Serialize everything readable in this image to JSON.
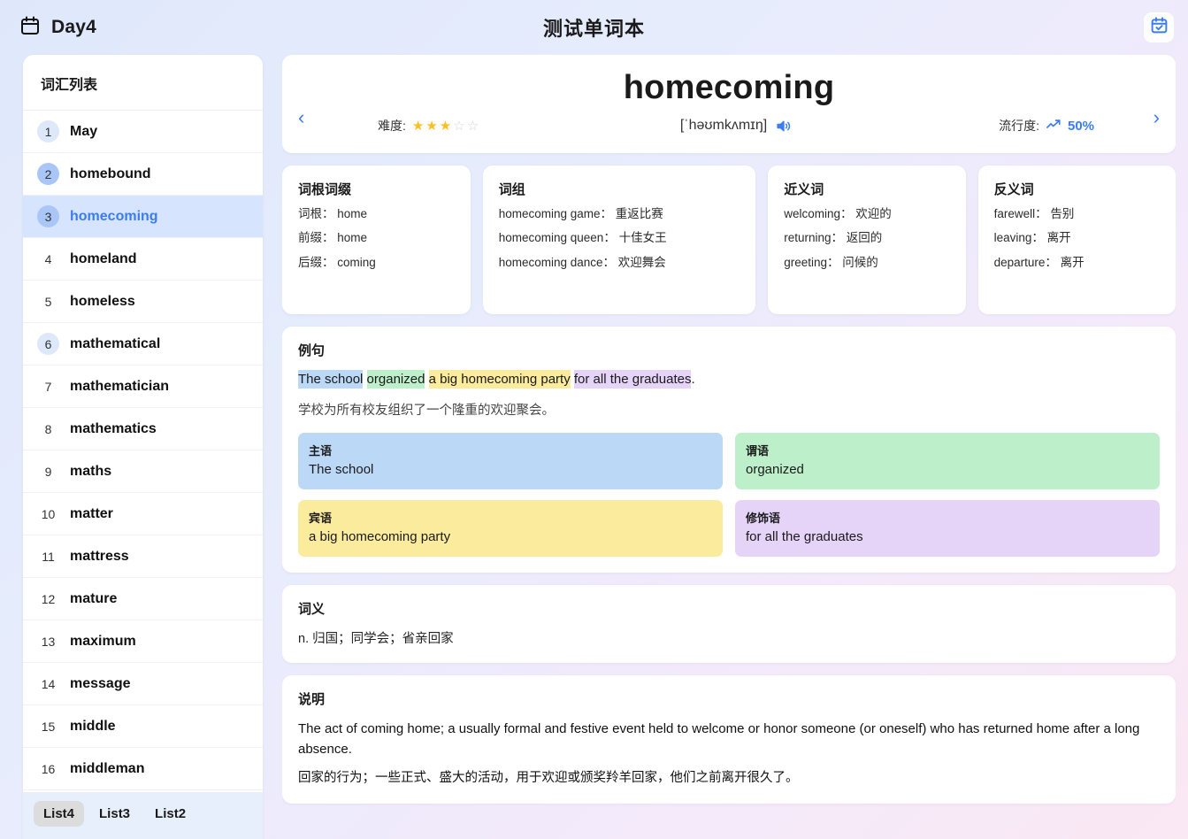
{
  "header": {
    "day_label": "Day4",
    "title": "测试单词本",
    "calendar_icon": "calendar-icon",
    "calendar_check_icon": "calendar-check-icon"
  },
  "sidebar": {
    "title": "词汇列表",
    "items": [
      {
        "num": "1",
        "word": "May",
        "badge": "light",
        "active": false
      },
      {
        "num": "2",
        "word": "homebound",
        "badge": "dark",
        "active": false
      },
      {
        "num": "3",
        "word": "homecoming",
        "badge": "dark",
        "active": true
      },
      {
        "num": "4",
        "word": "homeland",
        "badge": "none",
        "active": false
      },
      {
        "num": "5",
        "word": "homeless",
        "badge": "none",
        "active": false
      },
      {
        "num": "6",
        "word": "mathematical",
        "badge": "light",
        "active": false
      },
      {
        "num": "7",
        "word": "mathematician",
        "badge": "none",
        "active": false
      },
      {
        "num": "8",
        "word": "mathematics",
        "badge": "none",
        "active": false
      },
      {
        "num": "9",
        "word": "maths",
        "badge": "none",
        "active": false
      },
      {
        "num": "10",
        "word": "matter",
        "badge": "none",
        "active": false
      },
      {
        "num": "11",
        "word": "mattress",
        "badge": "none",
        "active": false
      },
      {
        "num": "12",
        "word": "mature",
        "badge": "none",
        "active": false
      },
      {
        "num": "13",
        "word": "maximum",
        "badge": "none",
        "active": false
      },
      {
        "num": "14",
        "word": "message",
        "badge": "none",
        "active": false
      },
      {
        "num": "15",
        "word": "middle",
        "badge": "none",
        "active": false
      },
      {
        "num": "16",
        "word": "middleman",
        "badge": "none",
        "active": false
      }
    ],
    "list_tabs": [
      {
        "label": "List4",
        "selected": true
      },
      {
        "label": "List3",
        "selected": false
      },
      {
        "label": "List2",
        "selected": false
      }
    ]
  },
  "hero": {
    "word": "homecoming",
    "phonetic": "[ˈhəʊmkʌmɪŋ]",
    "speaker_icon": "speaker-icon",
    "difficulty_label": "难度:",
    "difficulty_filled": 3,
    "difficulty_total": 5,
    "popularity_label": "流行度:",
    "popularity_value": "50%",
    "popularity_icon": "trending-up-icon",
    "prev_icon": "chevron-left-icon",
    "next_icon": "chevron-right-icon"
  },
  "info_cards": [
    {
      "title": "词根词缀",
      "lines": [
        "词根： home",
        "前缀： home",
        "后缀： coming"
      ]
    },
    {
      "title": "词组",
      "lines": [
        "homecoming game： 重返比赛",
        "homecoming queen： 十佳女王",
        "homecoming dance： 欢迎舞会"
      ]
    },
    {
      "title": "近义词",
      "lines": [
        "welcoming： 欢迎的",
        "returning： 返回的",
        "greeting： 问候的"
      ]
    },
    {
      "title": "反义词",
      "lines": [
        "farewell： 告别",
        "leaving： 离开",
        "departure： 离开"
      ]
    }
  ],
  "example": {
    "title": "例句",
    "segments": [
      {
        "text": "The school",
        "color": "#bcd8f7"
      },
      {
        "text": " ",
        "color": "transparent"
      },
      {
        "text": "organized",
        "color": "#bdf0ca"
      },
      {
        "text": " ",
        "color": "transparent"
      },
      {
        "text": "a big homecoming party",
        "color": "#fbeb9c"
      },
      {
        "text": " ",
        "color": "transparent"
      },
      {
        "text": "for all the graduates",
        "color": "#e6d4f8"
      },
      {
        "text": ".",
        "color": "transparent"
      }
    ],
    "translation": "学校为所有校友组织了一个隆重的欢迎聚会。",
    "grammar": [
      {
        "label": "主语",
        "value": "The school",
        "color": "#bcd8f7"
      },
      {
        "label": "谓语",
        "value": "organized",
        "color": "#bdf0ca"
      },
      {
        "label": "宾语",
        "value": "a big homecoming party",
        "color": "#fbeb9c"
      },
      {
        "label": "修饰语",
        "value": "for all the graduates",
        "color": "#e6d4f8"
      }
    ]
  },
  "meaning": {
    "title": "词义",
    "text": "n. 归国；同学会；省亲回家"
  },
  "description": {
    "title": "说明",
    "english": "The act of coming home; a usually formal and festive event held to welcome or honor someone (or oneself) who has returned home after a long absence.",
    "chinese": "回家的行为；一些正式、盛大的活动，用于欢迎或颁奖羚羊回家，他们之前离开很久了。"
  },
  "colors": {
    "accent": "#3b7cf0",
    "star_filled": "#fbbf24",
    "active_row": "#d6e4fd"
  }
}
